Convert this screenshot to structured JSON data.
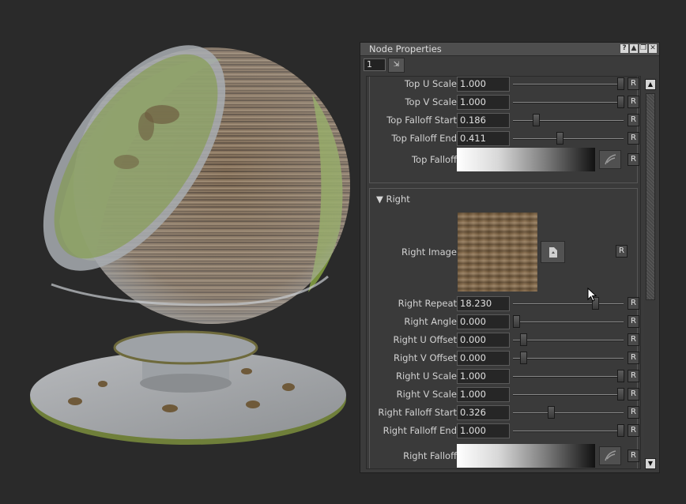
{
  "panel": {
    "title": "Node Properties",
    "node_number": "1",
    "pin_label": "⇲",
    "title_icons": [
      "help-icon",
      "minimize-icon",
      "restore-icon",
      "close-icon"
    ],
    "title_icon_glyphs": {
      "help": "?",
      "min": "▲",
      "restore": "❐",
      "close": "✕"
    }
  },
  "top_rows": [
    {
      "label": "Top U Scale",
      "value": "1.000",
      "level": 0.97
    },
    {
      "label": "Top V Scale",
      "value": "1.000",
      "level": 0.97
    },
    {
      "label": "Top Falloff Start",
      "value": "0.186",
      "level": 0.21
    },
    {
      "label": "Top Falloff End",
      "value": "0.411",
      "level": 0.42
    }
  ],
  "top_falloff": {
    "label": "Top Falloff"
  },
  "right_section": {
    "header": "Right",
    "image_label": "Right Image"
  },
  "right_rows": [
    {
      "label": "Right Repeat",
      "value": "18.230",
      "level": 0.74
    },
    {
      "label": "Right Angle",
      "value": "0.000",
      "level": 0.03
    },
    {
      "label": "Right U Offset",
      "value": "0.000",
      "level": 0.09
    },
    {
      "label": "Right V Offset",
      "value": "0.000",
      "level": 0.09
    },
    {
      "label": "Right U Scale",
      "value": "1.000",
      "level": 0.97
    },
    {
      "label": "Right V Scale",
      "value": "1.000",
      "level": 0.97
    },
    {
      "label": "Right Falloff Start",
      "value": "0.326",
      "level": 0.34
    },
    {
      "label": "Right Falloff End",
      "value": "1.000",
      "level": 0.97
    }
  ],
  "right_falloff": {
    "label": "Right Falloff"
  },
  "reset_label": "R",
  "colors": {
    "panel_bg": "#3b3b3b",
    "viewport_bg": "#2a2a2a",
    "field_bg": "#262626"
  }
}
